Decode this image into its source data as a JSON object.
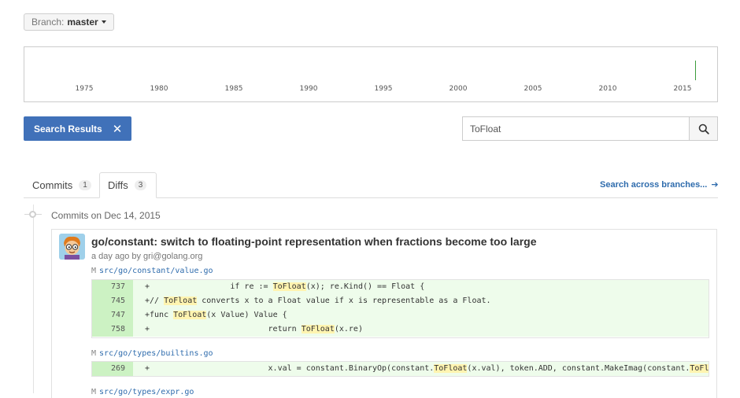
{
  "branch": {
    "label": "Branch:",
    "name": "master"
  },
  "timeline": {
    "years": [
      "1975",
      "1980",
      "1985",
      "1990",
      "1995",
      "2000",
      "2005",
      "2010",
      "2015"
    ],
    "marker_color": "#3c9c3c"
  },
  "search_results_badge": {
    "label": "Search Results",
    "close_symbol": "✕",
    "color": "#4071b9"
  },
  "search": {
    "value": "ToFloat",
    "button_icon": "search-icon"
  },
  "tabs": [
    {
      "label": "Commits",
      "count": "1"
    },
    {
      "label": "Diffs",
      "count": "3"
    }
  ],
  "search_across": {
    "label": "Search across branches...",
    "arrow": "➔"
  },
  "commit_group": {
    "date_heading": "Commits on Dec 14, 2015",
    "commits": [
      {
        "title": "go/constant: switch to floating-point representation when fractions become too large",
        "meta": "a day ago by gri@golang.org",
        "files": [
          {
            "status": "M",
            "path": "src/go/constant/value.go",
            "lines": [
              {
                "num": "737",
                "prefix": "+                 if re := ",
                "match": "ToFloat",
                "suffix": "(x); re.Kind() == Float {"
              },
              {
                "num": "745",
                "prefix": "+// ",
                "match": "ToFloat",
                "suffix": " converts x to a Float value if x is representable as a Float."
              },
              {
                "num": "747",
                "prefix": "+func ",
                "match": "ToFloat",
                "suffix": "(x Value) Value {"
              },
              {
                "num": "758",
                "prefix": "+                         return ",
                "match": "ToFloat",
                "suffix": "(x.re)"
              }
            ]
          },
          {
            "status": "M",
            "path": "src/go/types/builtins.go",
            "lines": [
              {
                "num": "269",
                "prefix": "+                         x.val = constant.BinaryOp(constant.",
                "match": "ToFloat",
                "suffix": "(x.val), token.ADD, constant.MakeImag(constant.",
                "match2": "ToFloat",
                "suffix2": "("
              }
            ]
          },
          {
            "status": "M",
            "path": "src/go/types/expr.go",
            "lines": []
          }
        ]
      }
    ]
  },
  "colors": {
    "added_line_number_bg": "#ccf2c3",
    "added_line_bg": "#eefceb",
    "match_highlight": "#fff4b0",
    "link": "#2f6cad"
  }
}
